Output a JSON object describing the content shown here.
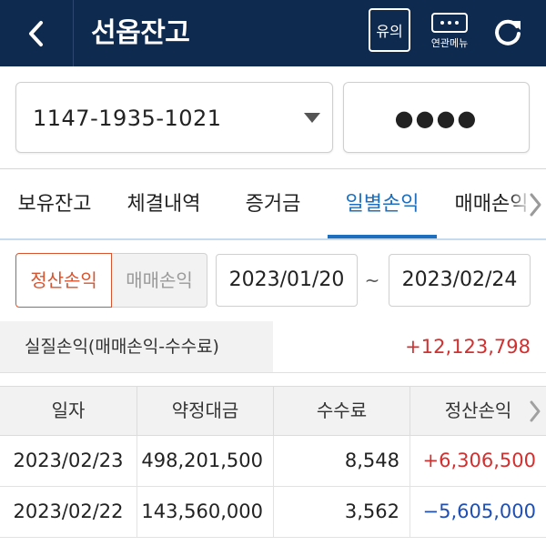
{
  "header": {
    "title": "선옵잔고",
    "notice_label": "유의",
    "menu_label": "연관메뉴"
  },
  "account": {
    "number": "1147-1935-1021",
    "password_mask": "●●●●"
  },
  "tabs": [
    {
      "label": "보유잔고"
    },
    {
      "label": "체결내역"
    },
    {
      "label": "증거금"
    },
    {
      "label": "일별손익"
    },
    {
      "label": "매매손익"
    }
  ],
  "active_tab": "일별손익",
  "filter": {
    "segment_settle": "정산손익",
    "segment_trade": "매매손익",
    "start_date": "2023/01/20",
    "separator": "~",
    "end_date": "2023/02/24"
  },
  "summary": {
    "label": "실질손익(매매손익-수수료)",
    "value": "+12,123,798"
  },
  "table": {
    "columns": [
      "일자",
      "약정대금",
      "수수료",
      "정산손익"
    ],
    "rows": [
      {
        "date": "2023/02/23",
        "amount": "498,201,500",
        "fee": "8,548",
        "pnl": "+6,306,500"
      },
      {
        "date": "2023/02/22",
        "amount": "143,560,000",
        "fee": "3,562",
        "pnl": "−5,605,000"
      }
    ]
  },
  "colors": {
    "header_bg": "#0f2a4f",
    "accent_blue": "#1e6fbd",
    "accent_orange": "#d9542e",
    "positive": "#d32f2f",
    "negative": "#1f4fb4"
  },
  "icons": {
    "back": "chevron-left-icon",
    "menu": "more-dots-icon",
    "refresh": "refresh-icon",
    "dropdown": "caret-down-icon",
    "scroll": "chevron-right-icon"
  }
}
